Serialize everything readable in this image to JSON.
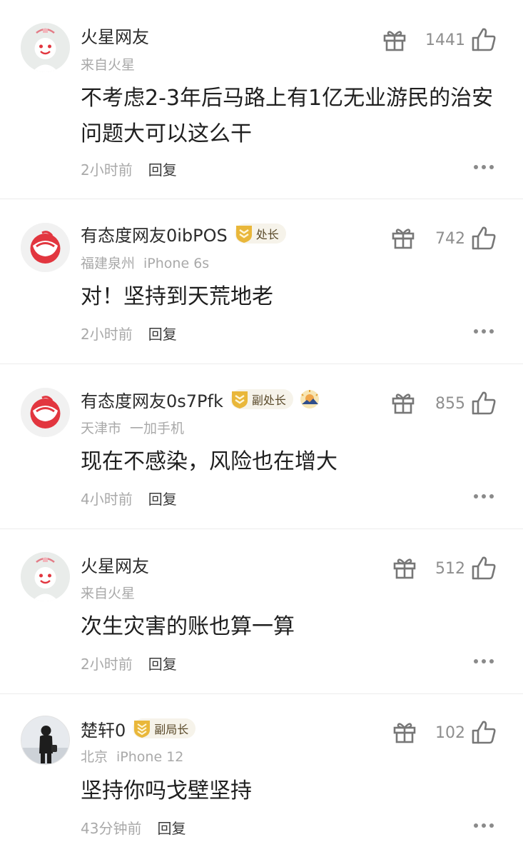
{
  "comments": [
    {
      "username": "火星网友",
      "badge": "",
      "location": "来自火星",
      "device": "",
      "text": "不考虑2-3年后马路上有1亿无业游民的治安问题大可以这么干",
      "time": "2小时前",
      "reply_label": "回复",
      "likes": "1441",
      "avatar": "mars-avatar-icon"
    },
    {
      "username": "有态度网友0ibPOS",
      "badge": "处长",
      "location": "福建泉州",
      "device": "iPhone 6s",
      "text": "对！坚持到天荒地老",
      "time": "2小时前",
      "reply_label": "回复",
      "likes": "742",
      "avatar": "netease-avatar-icon"
    },
    {
      "username": "有态度网友0s7Pfk",
      "badge": "副处长",
      "location": "天津市",
      "device": "一加手机",
      "text": "现在不感染，风险也在增大",
      "time": "4小时前",
      "reply_label": "回复",
      "likes": "855",
      "avatar": "netease-avatar-icon"
    },
    {
      "username": "火星网友",
      "badge": "",
      "location": "来自火星",
      "device": "",
      "text": "次生灾害的账也算一算",
      "time": "2小时前",
      "reply_label": "回复",
      "likes": "512",
      "avatar": "mars-avatar-icon"
    },
    {
      "username": "楚轩0",
      "badge": "副局长",
      "location": "北京",
      "device": "iPhone 12",
      "text": "坚持你吗戈壁坚持",
      "time": "43分钟前",
      "reply_label": "回复",
      "likes": "102",
      "avatar": "photo-avatar-icon"
    }
  ],
  "colors": {
    "text_primary": "#1f1f1f",
    "text_secondary": "#a9a9a9",
    "badge_gold": "#e9b73a",
    "netease_red": "#e2363f"
  }
}
